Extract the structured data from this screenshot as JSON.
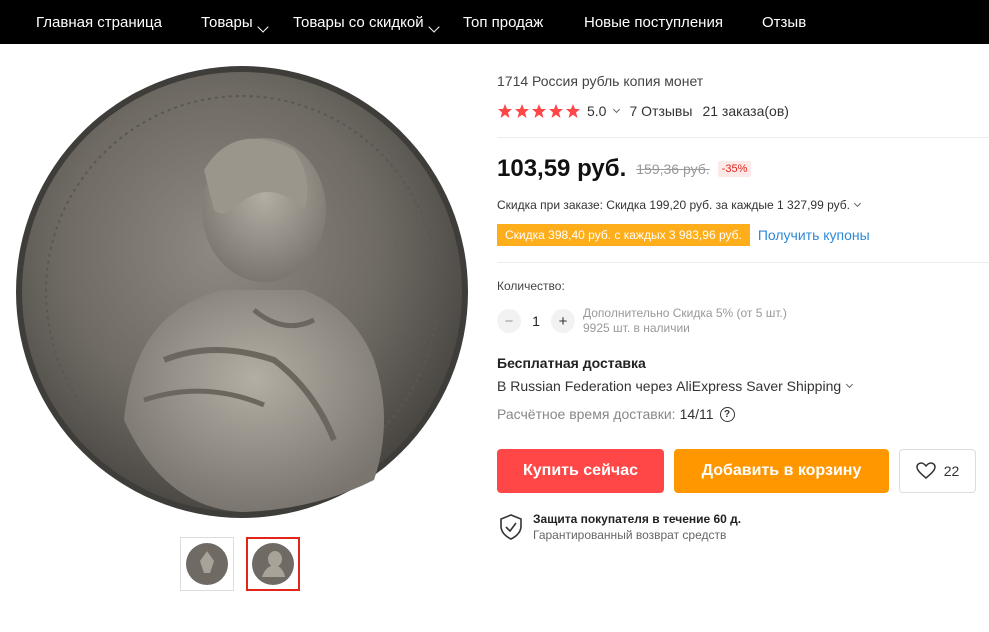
{
  "nav": {
    "items": [
      {
        "label": "Главная страница",
        "has_dropdown": false
      },
      {
        "label": "Товары",
        "has_dropdown": true
      },
      {
        "label": "Товары со скидкой",
        "has_dropdown": true
      },
      {
        "label": "Топ продаж",
        "has_dropdown": false
      },
      {
        "label": "Новые поступления",
        "has_dropdown": false
      },
      {
        "label": "Отзыв",
        "has_dropdown": false
      }
    ]
  },
  "product": {
    "title": "1714 Россия рубль копия монет",
    "rating": "5.0",
    "stars": 5,
    "reviews": "7 Отзывы",
    "orders": "21 заказа(ов)",
    "price": "103,59 руб.",
    "old_price": "159,36 руб.",
    "discount": "-35%",
    "order_discount": "Скидка при заказе: Скидка 199,20 руб. за каждые 1 327,99 руб.",
    "coupon": "Скидка 398,40 руб. с каждых 3 983,96 руб.",
    "get_coupons": "Получить купоны",
    "quantity_label": "Количество:",
    "quantity": "1",
    "qty_minus": "−",
    "qty_plus": "+",
    "qty_discount": "Дополнительно Скидка 5% (от 5 шт.)",
    "stock": "9925 шт. в наличии",
    "shipping_title": "Бесплатная доставка",
    "shipping_method": "В Russian Federation через AliExpress Saver Shipping",
    "delivery_label": "Расчётное время доставки:",
    "delivery_value": "14/11",
    "buy_now": "Купить сейчас",
    "add_to_cart": "Добавить в корзину",
    "wishlist_count": "22",
    "protection_title": "Защита покупателя в течение 60 д.",
    "protection_sub": "Гарантированный возврат средств"
  },
  "colors": {
    "nav_bg": "#000000",
    "star": "#ff4747",
    "buy": "#ff4747",
    "cart": "#ff9700",
    "coupon": "#ffae1b",
    "link": "#2f89d6",
    "discount": "#e1251b"
  },
  "icons": {
    "dropdown": "chevron-down-icon",
    "rating": "star-icon",
    "help": "question-circle-icon",
    "wishlist": "heart-icon",
    "protection": "shield-check-icon"
  }
}
